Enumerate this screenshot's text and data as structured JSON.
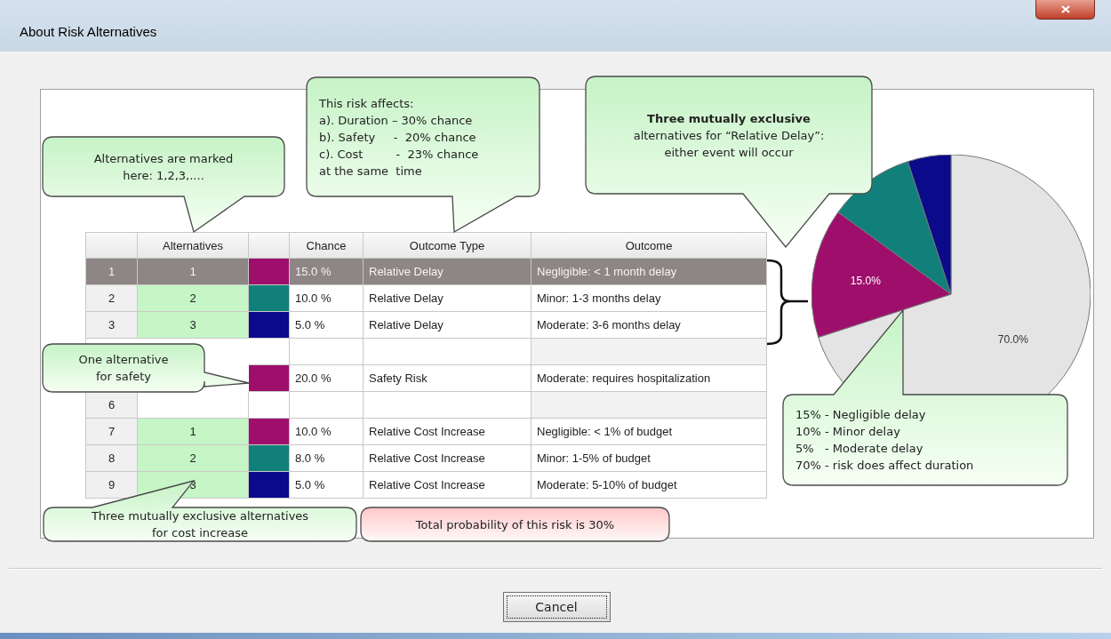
{
  "window": {
    "title": "About Risk Alternatives"
  },
  "table": {
    "columns": [
      "Alternatives",
      "Chance",
      "Outcome Type",
      "Outcome"
    ],
    "rows": [
      {
        "number": "1",
        "alternative": "1",
        "color": "#9e0f6c",
        "chance": "15.0 %",
        "outcome_type": "Relative Delay",
        "outcome": "Negligible: < 1 month delay",
        "selected": true
      },
      {
        "number": "2",
        "alternative": "2",
        "color": "#12807a",
        "chance": "10.0 %",
        "outcome_type": "Relative Delay",
        "outcome": "Minor: 1-3 months delay",
        "selected": false
      },
      {
        "number": "3",
        "alternative": "3",
        "color": "#0a0a8a",
        "chance": "5.0 %",
        "outcome_type": "Relative Delay",
        "outcome": "Moderate: 3-6 months delay",
        "selected": false
      },
      {
        "selected": false
      },
      {
        "color": "#9e0f6c",
        "chance": "20.0 %",
        "outcome_type": "Safety Risk",
        "outcome": "Moderate: requires hospitalization",
        "selected": false
      },
      {
        "number": "6",
        "selected": false
      },
      {
        "number": "7",
        "alternative": "1",
        "color": "#9e0f6c",
        "chance": "10.0 %",
        "outcome_type": "Relative Cost Increase",
        "outcome": "Negligible: < 1% of  budget",
        "selected": false
      },
      {
        "number": "8",
        "alternative": "2",
        "color": "#12807a",
        "chance": "8.0 %",
        "outcome_type": "Relative Cost Increase",
        "outcome": "Minor: 1-5% of  budget",
        "selected": false
      },
      {
        "number": "9",
        "alternative": "3",
        "color": "#0a0a8a",
        "chance": "5.0 %",
        "outcome_type": "Relative Cost Increase",
        "outcome": "Moderate: 5-10% of  budget",
        "selected": false
      }
    ]
  },
  "callouts": [
    {
      "kind": "note",
      "lines": [
        "Alternatives are marked",
        "here: 1,2,3,...."
      ]
    },
    {
      "kind": "note",
      "lines": [
        "This risk affects:",
        "a). Duration – 30% chance",
        "b). Safety     -  20% chance",
        "c). Cost         -  23% chance",
        "at the same  time"
      ]
    },
    {
      "kind": "note",
      "lines": [
        "**Three mutually exclusive**",
        "alternatives for “Relative Delay”:",
        "either event will occur"
      ]
    },
    {
      "kind": "note",
      "lines": [
        "One alternative",
        "for safety"
      ]
    },
    {
      "kind": "note",
      "lines": [
        "Three mutually exclusive alternatives",
        "for cost increase"
      ]
    },
    {
      "kind": "warning",
      "lines": [
        "Total probability of this risk is 30%"
      ]
    },
    {
      "kind": "note",
      "lines": [
        "15% - Negligible delay",
        "10% - Minor delay",
        "5%   - Moderate delay",
        "70% - risk does affect duration"
      ]
    }
  ],
  "chart_data": {
    "type": "pie",
    "values": [
      70,
      15,
      10,
      5
    ],
    "colors": [
      "#e4e4e4",
      "#9e0f6c",
      "#12807a",
      "#0a0a8a"
    ],
    "value_labels": [
      "70.0%",
      "15.0%",
      null,
      null
    ]
  },
  "buttons": [
    "Cancel"
  ]
}
